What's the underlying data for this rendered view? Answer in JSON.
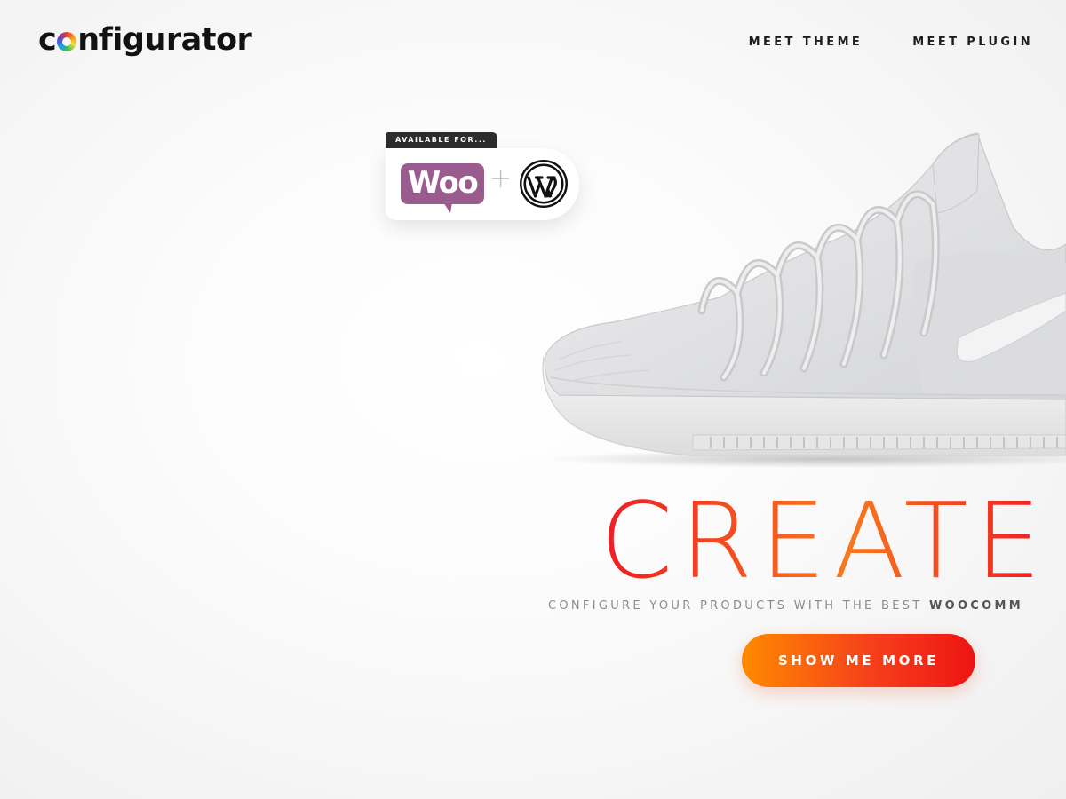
{
  "brand": {
    "prefix": "c",
    "suffix": "nfigurator"
  },
  "nav": {
    "items": [
      "MEET THEME",
      "MEET PLUGIN"
    ]
  },
  "badge": {
    "tag": "AVAILABLE FOR...",
    "woo_label": "Woo",
    "plus": "+",
    "icons": [
      "woocommerce-logo",
      "wordpress-logo"
    ]
  },
  "hero": {
    "headline": "CREATE",
    "sub_prefix": "CONFIGURE YOUR PRODUCTS WITH THE BEST ",
    "sub_emphasis": "WOOCOMM",
    "cta": "SHOW ME MORE"
  },
  "colors": {
    "accent_start": "#ff8a00",
    "accent_end": "#ee1414",
    "woo_purple": "#9a5c8f",
    "text_dark": "#1d1d1d"
  }
}
